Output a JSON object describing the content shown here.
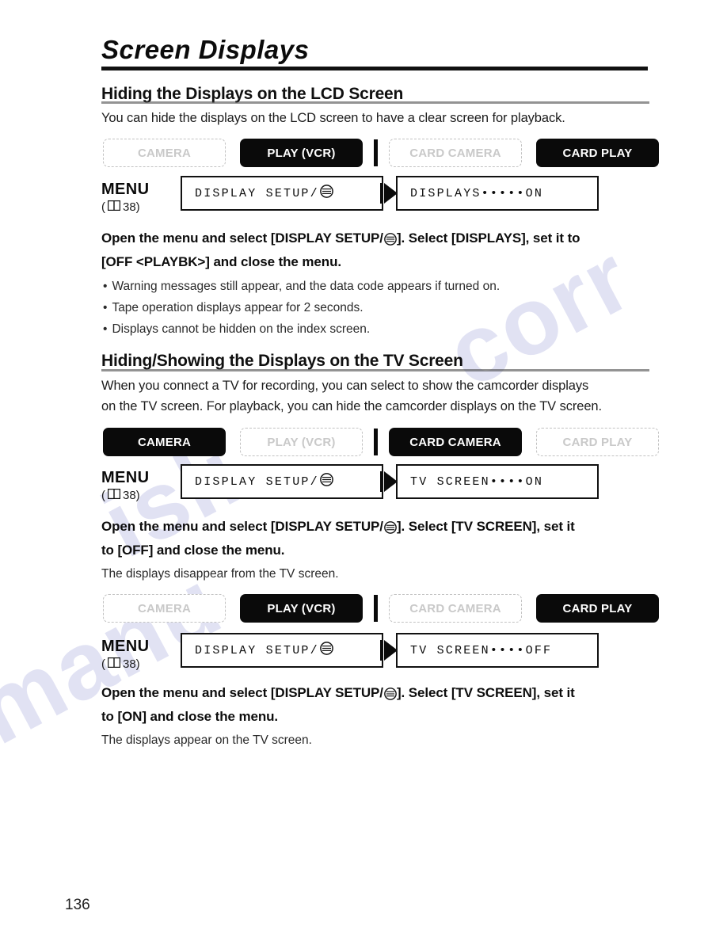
{
  "document": {
    "title": "Screen Displays",
    "page_number": "136"
  },
  "icons": {
    "book": "book-icon",
    "display_setup": "display-setup-icon",
    "arrow": "right-arrow-icon"
  },
  "colors": {
    "active_badge_bg": "#0a0a0a",
    "active_badge_text": "#ffffff",
    "inactive_badge_text": "#c9c9c9",
    "inactive_badge_border": "#c2c2c2",
    "rule": "#111111",
    "watermark": "#b9bce4"
  },
  "watermark": {
    "line1": "corr",
    "line2": "isli",
    "line3": "manu"
  },
  "sections": [
    {
      "heading": "Hiding the Displays on the LCD Screen",
      "intro": "You can hide the displays on the LCD screen to have a clear screen for playback.",
      "modes": [
        {
          "label": "CAMERA",
          "active": false
        },
        {
          "label": "PLAY (VCR)",
          "active": true
        },
        {
          "label": "CARD CAMERA",
          "active": false
        },
        {
          "label": "CARD PLAY",
          "active": true
        }
      ],
      "menu": {
        "label": "MENU",
        "page_ref": "38)",
        "page_ref_open": "(",
        "box1": "DISPLAY SETUP/",
        "box2": "DISPLAYS•••••ON"
      },
      "instruction_line1": "Open the menu and select [DISPLAY SETUP/",
      "instruction_line1b": "]. Select [DISPLAYS], set it to",
      "instruction_line2": "[OFF <PLAYBK>] and close the menu.",
      "bullets": [
        "Warning messages still appear, and the data code appears if turned on.",
        "Tape operation displays appear for 2 seconds.",
        "Displays cannot be hidden on the index screen."
      ]
    },
    {
      "heading": "Hiding/Showing the Displays on the TV Screen",
      "intro_line1": "When you connect a TV for recording, you can select to show the camcorder displays",
      "intro_line2": "on the TV screen. For playback, you can hide the camcorder displays on the TV screen.",
      "modes": [
        {
          "label": "CAMERA",
          "active": true
        },
        {
          "label": "PLAY (VCR)",
          "active": false
        },
        {
          "label": "CARD CAMERA",
          "active": true
        },
        {
          "label": "CARD PLAY",
          "active": false
        }
      ],
      "menu": {
        "label": "MENU",
        "page_ref": "38)",
        "page_ref_open": "(",
        "box1": "DISPLAY SETUP/",
        "box2": "TV SCREEN••••ON"
      },
      "instruction_line1": "Open the menu and select [DISPLAY SETUP/",
      "instruction_line1b": "]. Select [TV SCREEN], set it",
      "instruction_line2": "to [OFF] and close the menu.",
      "note": "The displays disappear from the TV screen."
    },
    {
      "modes": [
        {
          "label": "CAMERA",
          "active": false
        },
        {
          "label": "PLAY (VCR)",
          "active": true
        },
        {
          "label": "CARD CAMERA",
          "active": false
        },
        {
          "label": "CARD PLAY",
          "active": true
        }
      ],
      "menu": {
        "label": "MENU",
        "page_ref": "38)",
        "page_ref_open": "(",
        "box1": "DISPLAY SETUP/",
        "box2": "TV SCREEN••••OFF"
      },
      "instruction_line1": "Open the menu and select [DISPLAY SETUP/",
      "instruction_line1b": "]. Select [TV SCREEN], set it",
      "instruction_line2": "to [ON] and close the menu.",
      "note": "The displays appear on the TV screen."
    }
  ]
}
